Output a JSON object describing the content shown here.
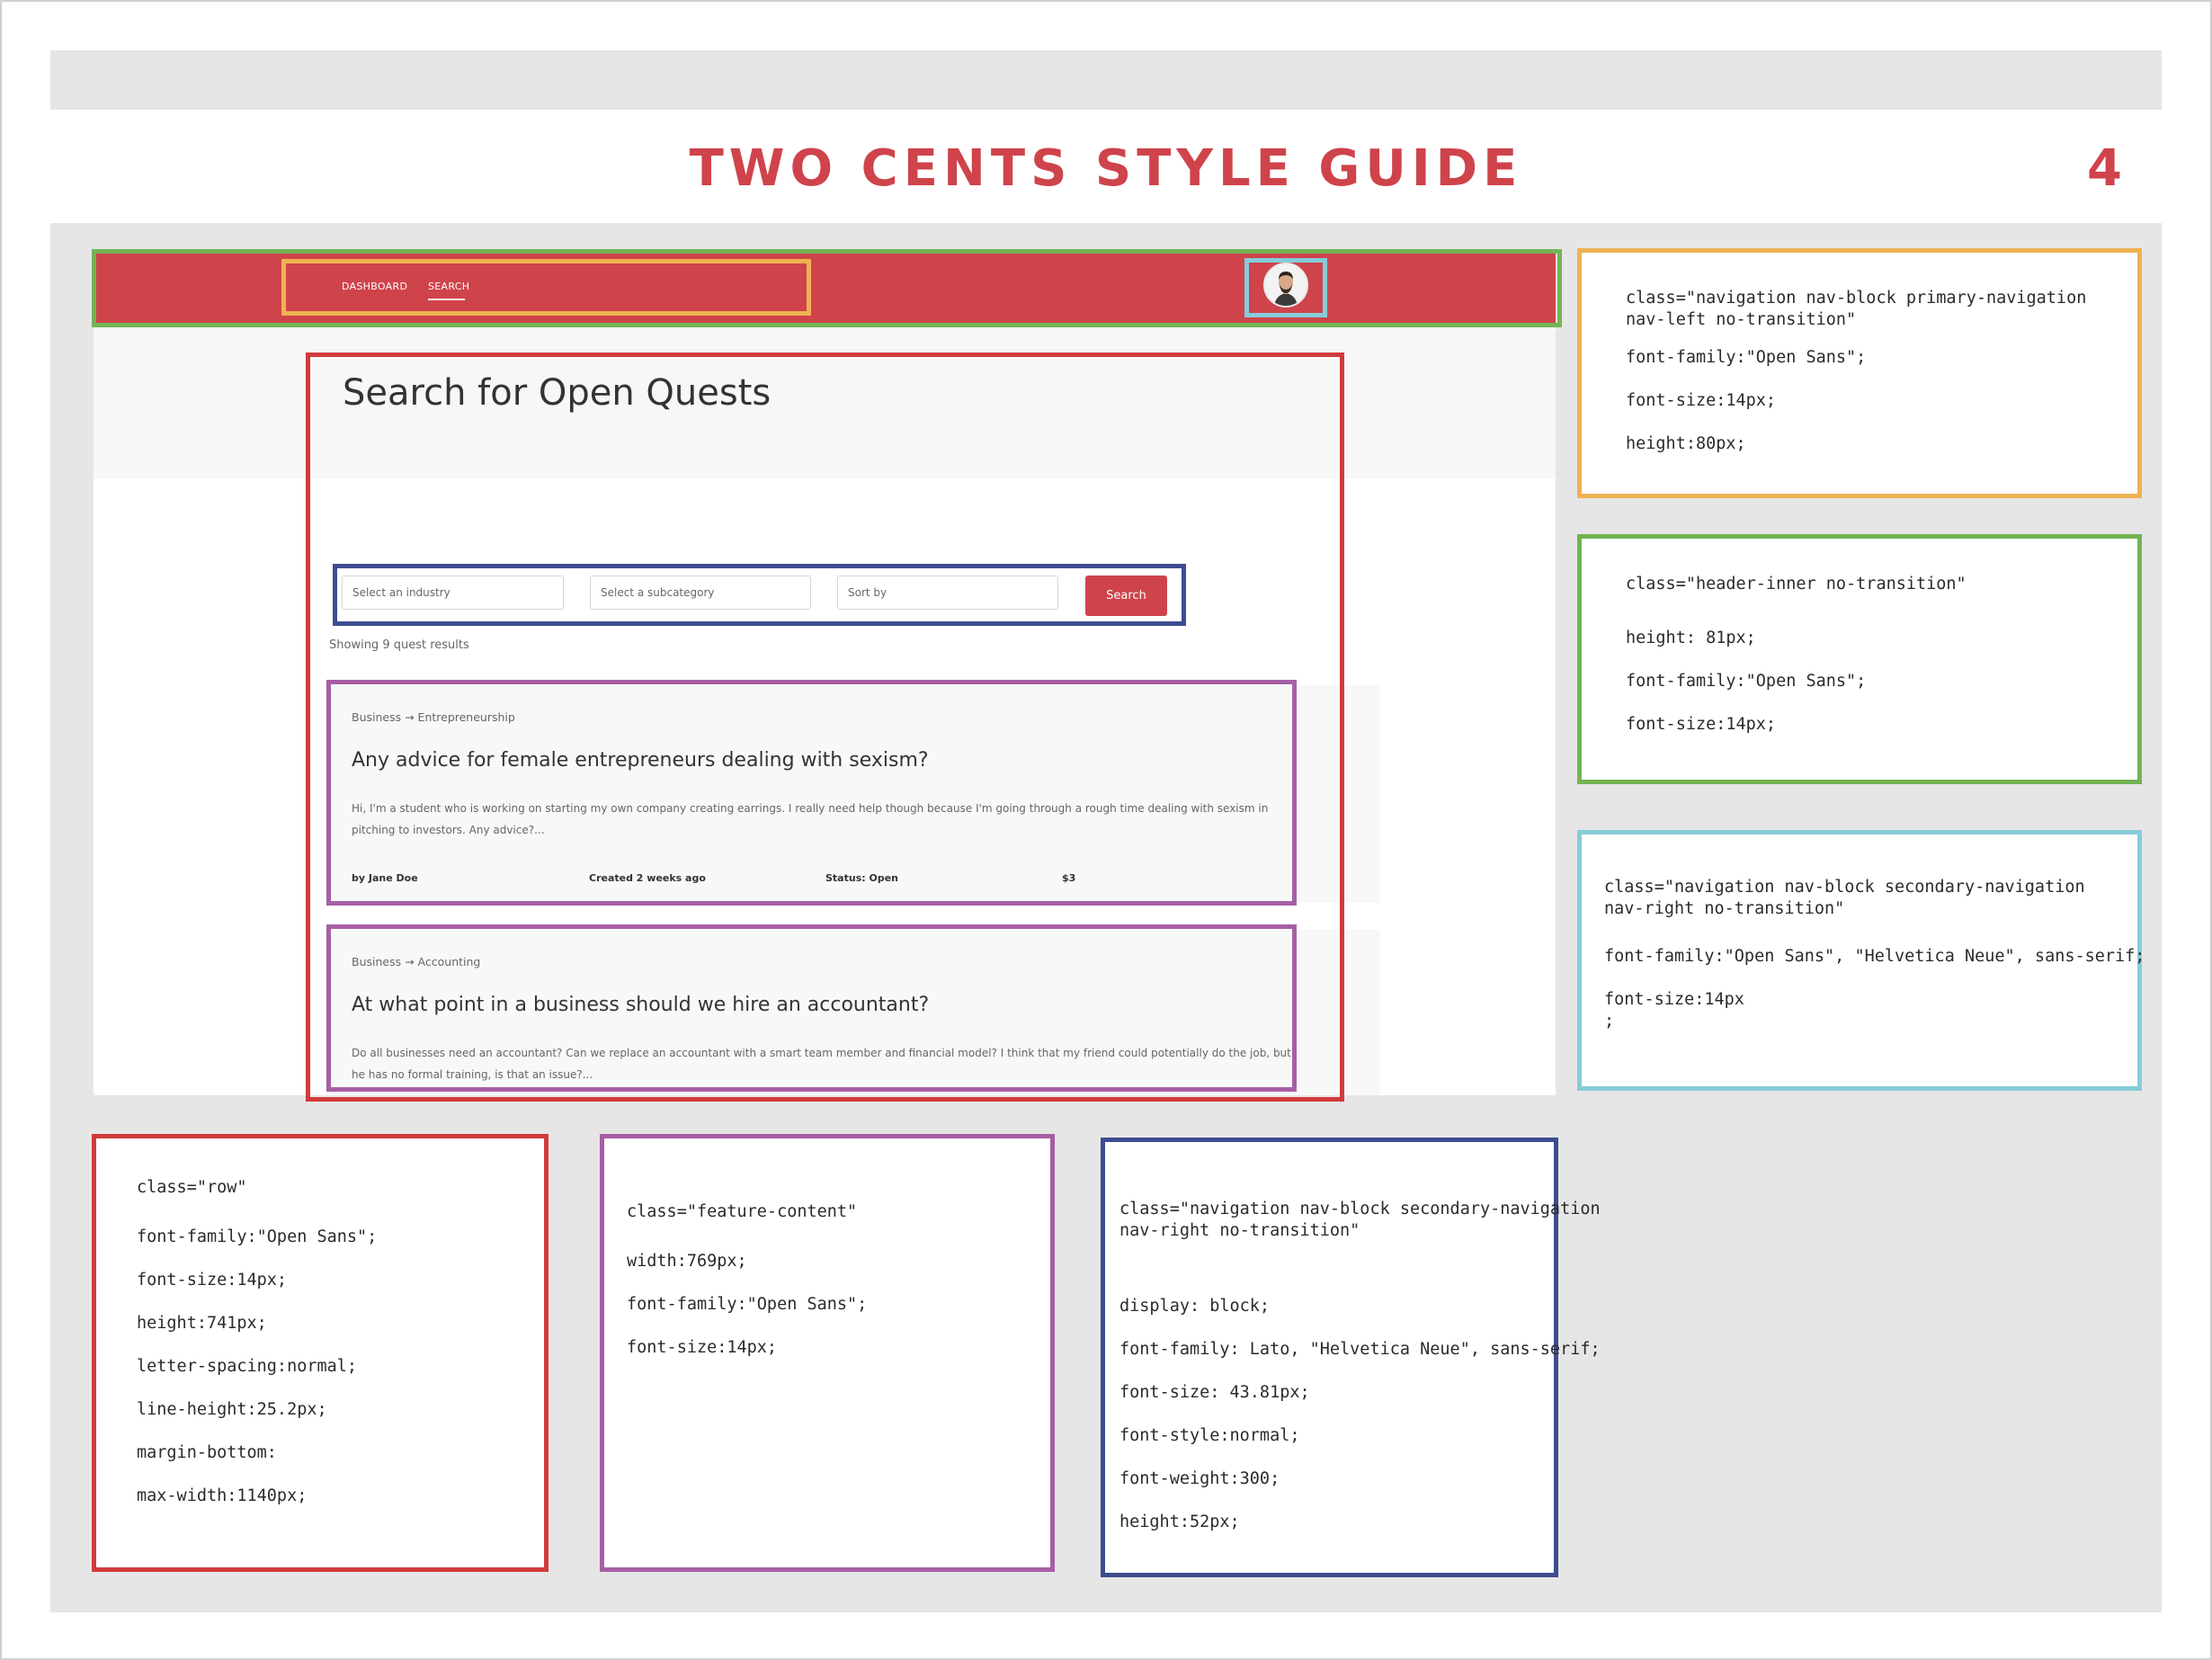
{
  "doc": {
    "title": "TWO CENTS STYLE GUIDE",
    "page_number": "4"
  },
  "app": {
    "nav": {
      "dashboard": "DASHBOARD",
      "search": "SEARCH"
    },
    "hero_title": "Search for Open Quests",
    "filters": {
      "industry": "Select an industry",
      "subcategory": "Select a subcategory",
      "sort": "Sort by",
      "search_button": "Search"
    },
    "result_count": "Showing 9 quest results",
    "cards": [
      {
        "breadcrumb": "Business → Entrepreneurship",
        "title": "Any advice for female entrepreneurs dealing with sexism?",
        "body": "Hi, I'm a student who is working on starting my own company creating earrings. I really need help though because I'm going through a rough time dealing with sexism in pitching to investors. Any advice?...",
        "author": "by Jane Doe",
        "created": "Created 2 weeks ago",
        "status": "Status: Open",
        "price": "$3"
      },
      {
        "breadcrumb": "Business → Accounting",
        "title": "At what point in a business should we hire an accountant?",
        "body": "Do all businesses need an accountant? Can we replace an accountant with a smart team member and financial model? I think that my friend could potentially do the job, but he has no formal training, is that an issue?..."
      }
    ]
  },
  "notes": {
    "orange": [
      "class=\"navigation nav-block primary-navigation",
      "nav-left no-transition\"",
      "font-family:\"Open Sans\";",
      "font-size:14px;",
      "height:80px;"
    ],
    "green": [
      "class=\"header-inner no-transition\"",
      "height: 81px;",
      "font-family:\"Open Sans\";",
      "font-size:14px;"
    ],
    "cyan": [
      "class=\"navigation nav-block secondary-navigation",
      "nav-right no-transition\"",
      "font-family:\"Open Sans\", \"Helvetica Neue\", sans-serif;",
      "font-size:14px",
      ";"
    ],
    "red": [
      "class=\"row\"",
      "font-family:\"Open Sans\";",
      "font-size:14px;",
      "height:741px;",
      "letter-spacing:normal;",
      "line-height:25.2px;",
      "margin-bottom:",
      "max-width:1140px;"
    ],
    "purple": [
      "class=\"feature-content\"",
      "width:769px;",
      "font-family:\"Open Sans\";",
      "font-size:14px;"
    ],
    "navy": [
      "class=\"navigation nav-block secondary-navigation",
      "nav-right no-transition\"",
      "display: block;",
      "font-family: Lato, \"Helvetica Neue\", sans-serif;",
      "font-size: 43.81px;",
      "font-style:normal;",
      "font-weight:300;",
      "height:52px;"
    ]
  },
  "colors": {
    "brand_red": "#cf434b",
    "highlight_green": "#73b454",
    "highlight_orange": "#efb252",
    "highlight_cyan": "#86ccd9",
    "highlight_red": "#d13b3b",
    "highlight_navy": "#3e4c90",
    "highlight_purple": "#a75ea5"
  }
}
